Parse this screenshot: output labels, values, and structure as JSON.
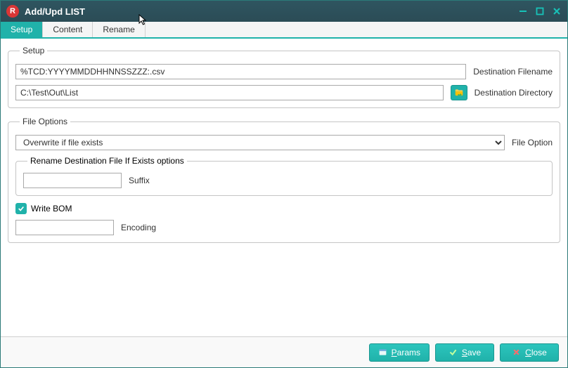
{
  "window": {
    "title": "Add/Upd LIST",
    "app_icon_letter": "R"
  },
  "tabs": {
    "setup": "Setup",
    "content": "Content",
    "rename": "Rename"
  },
  "setup_group": {
    "legend": "Setup",
    "dest_filename_value": "%TCD:YYYYMMDDHHNNSSZZZ:.csv",
    "dest_filename_label": "Destination Filename",
    "dest_dir_value": "C:\\Test\\Out\\List",
    "dest_dir_label": "Destination Directory"
  },
  "file_options_group": {
    "legend": "File Options",
    "file_option_selected": "Overwrite if file exists",
    "file_option_label": "File Option",
    "rename_subgroup_legend": "Rename Destination File If Exists options",
    "suffix_value": "",
    "suffix_label": "Suffix",
    "write_bom_checked": true,
    "write_bom_label": "Write BOM",
    "encoding_value": "",
    "encoding_label": "Encoding"
  },
  "buttons": {
    "params": "Params",
    "save": "Save",
    "close": "Close"
  }
}
